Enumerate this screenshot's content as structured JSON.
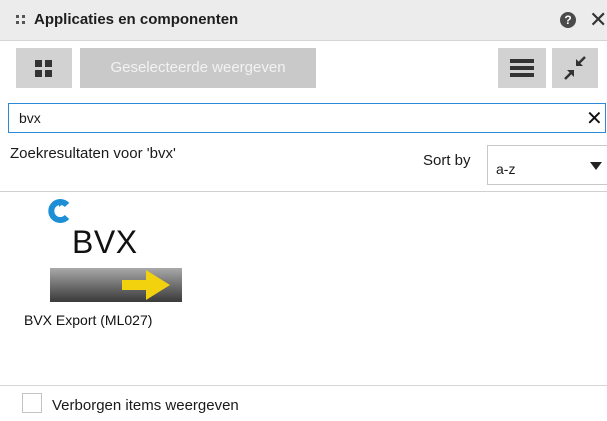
{
  "window": {
    "title": "Applicaties en componenten",
    "title_icon": "grip-icon",
    "help_icon": "question-icon",
    "close_icon": "close-icon"
  },
  "toolbar": {
    "grid_view_icon": "grid-icon",
    "show_selected_label": "Geselecteerde weergeven",
    "show_selected_enabled": false,
    "list_view_icon": "list-icon",
    "collapse_icon": "collapse-icon"
  },
  "search": {
    "value": "bvx",
    "clear_icon": "clear-icon"
  },
  "results": {
    "heading": "Zoekresultaten voor 'bvx'",
    "sort_label": "Sort by",
    "sort_value": "a-z",
    "items": [
      {
        "logo_text": "BVX",
        "caption": "BVX Export (ML027)"
      }
    ]
  },
  "footer": {
    "hidden_items_label": "Verborgen items weergeven",
    "hidden_items_checked": false
  },
  "colors": {
    "accent": "#2b89d8",
    "arrow": "#f2d20f",
    "titlebar": "#ececec",
    "button": "#d2d2d2",
    "button_disabled": "#c9c9c9"
  }
}
